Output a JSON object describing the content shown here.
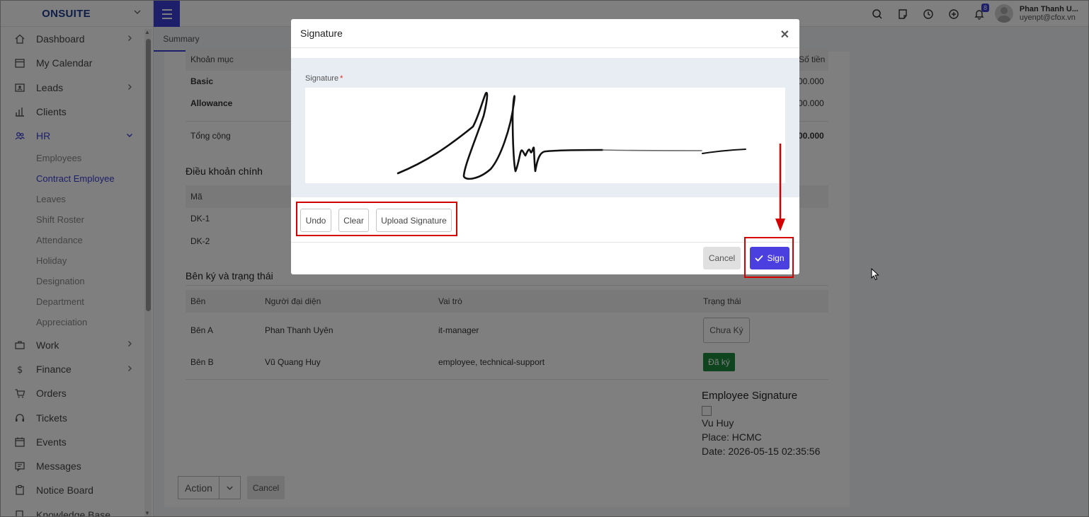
{
  "brand": {
    "name": "ONSUITE"
  },
  "sidebar": {
    "items": [
      {
        "label": "Dashboard",
        "icon": "home-icon",
        "has_arrow": true
      },
      {
        "label": "My Calendar",
        "icon": "calendar-icon",
        "has_arrow": false
      },
      {
        "label": "Leads",
        "icon": "contact-card-icon",
        "has_arrow": true
      },
      {
        "label": "Clients",
        "icon": "chart-icon",
        "has_arrow": false
      },
      {
        "label": "HR",
        "icon": "users-icon",
        "has_arrow": true,
        "expanded": true
      }
    ],
    "hr_sub": [
      "Employees",
      "Contract Employee",
      "Leaves",
      "Shift Roster",
      "Attendance",
      "Holiday",
      "Designation",
      "Department",
      "Appreciation"
    ],
    "hr_active": "Contract Employee",
    "items_after": [
      {
        "label": "Work",
        "icon": "briefcase-icon",
        "has_arrow": true
      },
      {
        "label": "Finance",
        "icon": "dollar-icon",
        "has_arrow": true
      },
      {
        "label": "Orders",
        "icon": "cart-icon",
        "has_arrow": false
      },
      {
        "label": "Tickets",
        "icon": "headset-icon",
        "has_arrow": false
      },
      {
        "label": "Events",
        "icon": "event-calendar-icon",
        "has_arrow": false
      },
      {
        "label": "Messages",
        "icon": "message-icon",
        "has_arrow": false
      },
      {
        "label": "Notice Board",
        "icon": "clipboard-icon",
        "has_arrow": false
      },
      {
        "label": "Knowledge Base",
        "icon": "book-icon",
        "has_arrow": false
      }
    ]
  },
  "topbar": {
    "notification_count": "8",
    "user_name": "Phan Thanh U...",
    "user_email": "uyenpt@cfox.vn"
  },
  "tabs": {
    "summary": "Summary"
  },
  "salary_table": {
    "headers": {
      "item": "Khoản mục",
      "amount": "Số tiền"
    },
    "rows": [
      {
        "item": "Basic",
        "amount": "00.000"
      },
      {
        "item": "Allowance",
        "amount": "00.000"
      }
    ],
    "total_label": "Tổng cộng",
    "total_amount": "00.000"
  },
  "terms": {
    "title": "Điều khoản chính",
    "header_code": "Mã",
    "rows": [
      "DK-1",
      "DK-2"
    ]
  },
  "parties": {
    "title": "Bên ký và trạng thái",
    "headers": {
      "party": "Bên",
      "rep": "Người đại diện",
      "role": "Vai trò",
      "status": "Trạng thái"
    },
    "rows": [
      {
        "party": "Bên A",
        "rep": "Phan Thanh Uyên",
        "role": "it-manager",
        "status": "Chưa Ký"
      },
      {
        "party": "Bên B",
        "rep": "Vũ Quang Huy",
        "role": "employee, technical-support",
        "status": "Đã ký"
      }
    ]
  },
  "employee_signature": {
    "title": "Employee Signature",
    "name": "Vu Huy",
    "place": "Place: HCMC",
    "date": "Date: 2026-05-15 02:35:56"
  },
  "footer_actions": {
    "action": "Action",
    "cancel": "Cancel"
  },
  "modal": {
    "title": "Signature",
    "field_label": "Signature",
    "required_mark": "*",
    "undo": "Undo",
    "clear": "Clear",
    "upload": "Upload Signature",
    "cancel": "Cancel",
    "sign": "Sign"
  },
  "colors": {
    "accent": "#3a3fd4",
    "sign_button": "#4b3fe0",
    "signed_badge": "#1e8a3c",
    "annotation": "#d40000"
  }
}
